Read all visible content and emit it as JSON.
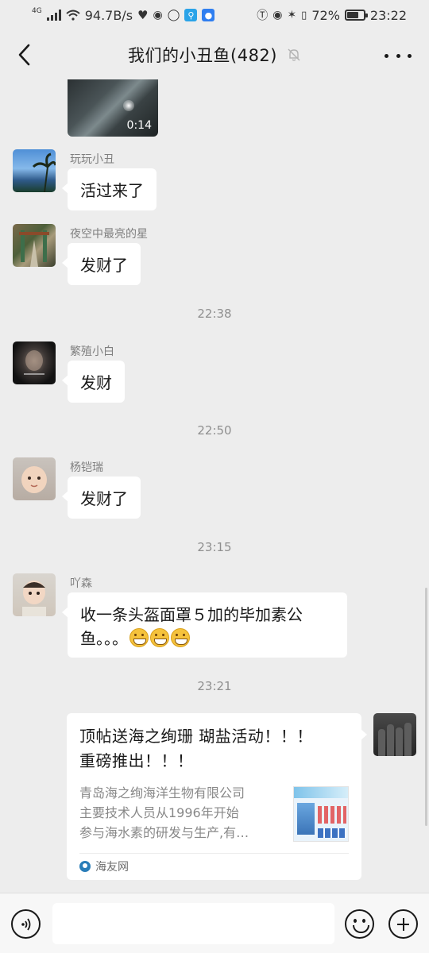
{
  "status_bar": {
    "network_type": "4G",
    "speed": "94.7B/s",
    "battery": "72%",
    "battery_level": 0.72,
    "time": "23:22",
    "icons": [
      "signal-icon",
      "wifi-icon",
      "heart-icon",
      "globe-icon",
      "circle-icon",
      "search-app-icon",
      "bulb-app-icon",
      "nfc-icon",
      "eye-icon",
      "bluetooth-icon",
      "vibrate-icon",
      "battery-icon"
    ]
  },
  "nav": {
    "title": "我们的小丑鱼(482)",
    "back_icon": "chevron-left-icon",
    "mute_icon": "bell-off-icon",
    "more_icon": "more-dots-icon"
  },
  "video": {
    "duration": "0:14"
  },
  "messages": [
    {
      "sender": "玩玩小丑",
      "text": "活过来了",
      "avatar": "beach-palm-avatar"
    },
    {
      "sender": "夜空中最亮的星",
      "text": "发财了",
      "avatar": "street-avatar"
    },
    {
      "time": "22:38"
    },
    {
      "sender": "繁殖小白",
      "text": "发财",
      "avatar": "dark-portrait-avatar"
    },
    {
      "time": "22:50"
    },
    {
      "sender": "杨铠瑞",
      "text": "发财了",
      "avatar": "baby-avatar"
    },
    {
      "time": "23:15"
    },
    {
      "sender": "吖森",
      "text_line1": "收一条头盔面罩５加的毕加素公",
      "text_line2": "鱼。。。",
      "emoji_count": 3,
      "avatar": "child-avatar"
    },
    {
      "time": "23:21"
    }
  ],
  "link_card": {
    "title_line1": "顶帖送海之绚珊 瑚盐活动！！！",
    "title_line2": "重磅推出！！！",
    "desc_line1": "青岛海之绚海洋生物有限公司",
    "desc_line2": "主要技术人员从1996年开始",
    "desc_line3": "参与海水素的研发与生产,有…",
    "source": "海友网"
  },
  "input_bar": {
    "placeholder": "",
    "voice_icon": "voice-icon",
    "emoji_icon": "smiley-icon",
    "plus_icon": "plus-icon"
  }
}
